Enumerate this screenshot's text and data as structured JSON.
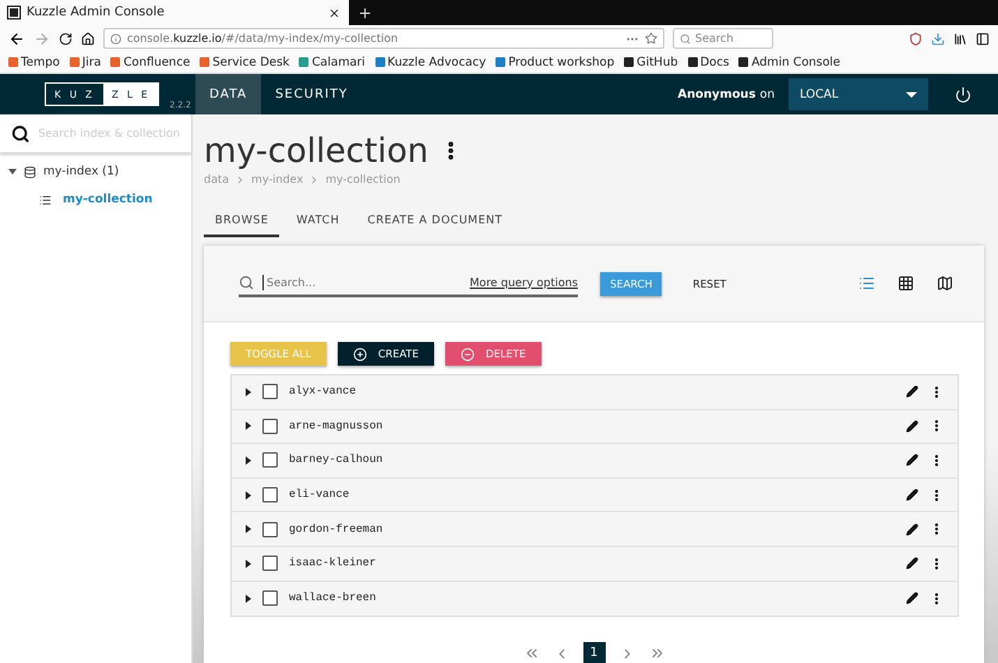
{
  "browser": {
    "tab_title": "Kuzzle Admin Console",
    "url_prefix": "console.",
    "url_domain": "kuzzle.io",
    "url_path": "/#/data/my-index/my-collection",
    "search_placeholder": "Search",
    "bookmarks": [
      {
        "label": "Tempo",
        "color": "#e8622c"
      },
      {
        "label": "Jira",
        "color": "#e8622c"
      },
      {
        "label": "Confluence",
        "color": "#e8622c"
      },
      {
        "label": "Service Desk",
        "color": "#e8622c"
      },
      {
        "label": "Calamari",
        "color": "#2a9d8f"
      },
      {
        "label": "Kuzzle Advocacy",
        "color": "#1f7fc4"
      },
      {
        "label": "Product workshop",
        "color": "#1f7fc4"
      },
      {
        "label": "GitHub",
        "color": "#222222"
      },
      {
        "label": "Docs",
        "color": "#222222"
      },
      {
        "label": "Admin Console",
        "color": "#222222"
      }
    ]
  },
  "header": {
    "logo_left": "K U Z",
    "logo_right": "Z L E",
    "version": "2.2.2",
    "nav": [
      {
        "label": "DATA",
        "selected": true
      },
      {
        "label": "SECURITY",
        "selected": false
      }
    ],
    "user": "Anonymous",
    "user_suffix": "on",
    "environment": "LOCAL"
  },
  "sidebar": {
    "search_placeholder": "Search index & collection",
    "tree": [
      {
        "label": "my-index (1)",
        "expanded": true,
        "children": [
          {
            "label": "my-collection",
            "selected": true
          }
        ]
      }
    ]
  },
  "page": {
    "title": "my-collection",
    "breadcrumb": [
      "data",
      "my-index",
      "my-collection"
    ],
    "tabs": [
      {
        "label": "BROWSE",
        "selected": true
      },
      {
        "label": "WATCH",
        "selected": false
      },
      {
        "label": "CREATE A DOCUMENT",
        "selected": false
      }
    ],
    "query": {
      "placeholder": "Search...",
      "more_options": "More query options",
      "search_button": "SEARCH",
      "reset_button": "RESET"
    },
    "views": [
      {
        "kind": "list",
        "selected": true
      },
      {
        "kind": "grid",
        "selected": false
      },
      {
        "kind": "map",
        "selected": false
      }
    ],
    "actions": {
      "toggle_all": "TOGGLE ALL",
      "create": "CREATE",
      "delete": "DELETE"
    },
    "documents": [
      {
        "id": "alyx-vance",
        "checked": false
      },
      {
        "id": "arne-magnusson",
        "checked": false
      },
      {
        "id": "barney-calhoun",
        "checked": false
      },
      {
        "id": "eli-vance",
        "checked": false
      },
      {
        "id": "gordon-freeman",
        "checked": false
      },
      {
        "id": "isaac-kleiner",
        "checked": false
      },
      {
        "id": "wallace-breen",
        "checked": false
      }
    ],
    "pagination": {
      "pages": [
        {
          "label": "1",
          "selected": true
        }
      ]
    }
  }
}
